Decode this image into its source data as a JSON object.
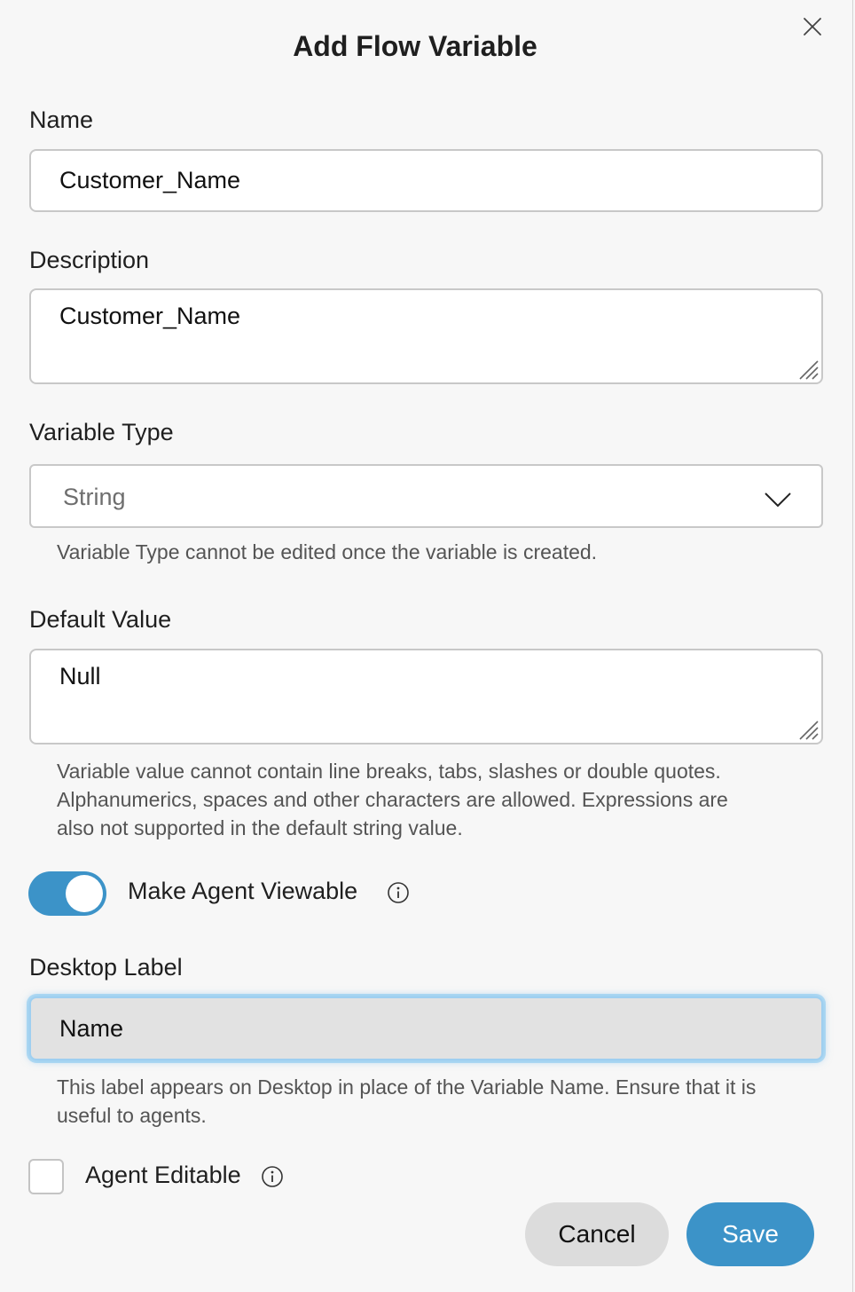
{
  "dialog": {
    "title": "Add Flow Variable",
    "close_icon": "close-icon"
  },
  "name": {
    "label": "Name",
    "value": "Customer_Name"
  },
  "description": {
    "label": "Description",
    "value": "Customer_Name"
  },
  "variable_type": {
    "label": "Variable Type",
    "selected": "String",
    "chevron_icon": "chevron-down-icon",
    "help": "Variable Type cannot be edited once the variable is created."
  },
  "default_value": {
    "label": "Default Value",
    "value": "Null",
    "help_lines": [
      "Variable value cannot contain line breaks, tabs, slashes or double quotes.",
      "Alphanumerics, spaces and other characters are allowed. Expressions are",
      "also not supported in the default string value."
    ]
  },
  "agent_viewable": {
    "label": "Make Agent Viewable",
    "enabled": true,
    "info_icon": "info-icon"
  },
  "desktop_label": {
    "label": "Desktop Label",
    "value": "Name",
    "help_lines": [
      "This label appears on Desktop in place of the Variable Name. Ensure that it is",
      "useful to agents."
    ]
  },
  "agent_editable": {
    "label": "Agent Editable",
    "checked": false,
    "info_icon": "info-icon"
  },
  "actions": {
    "cancel_label": "Cancel",
    "save_label": "Save"
  },
  "colors": {
    "accent": "#3c93c8",
    "focus_glow": "#9fcff0",
    "focused_field_bg": "#e2e2e2"
  }
}
